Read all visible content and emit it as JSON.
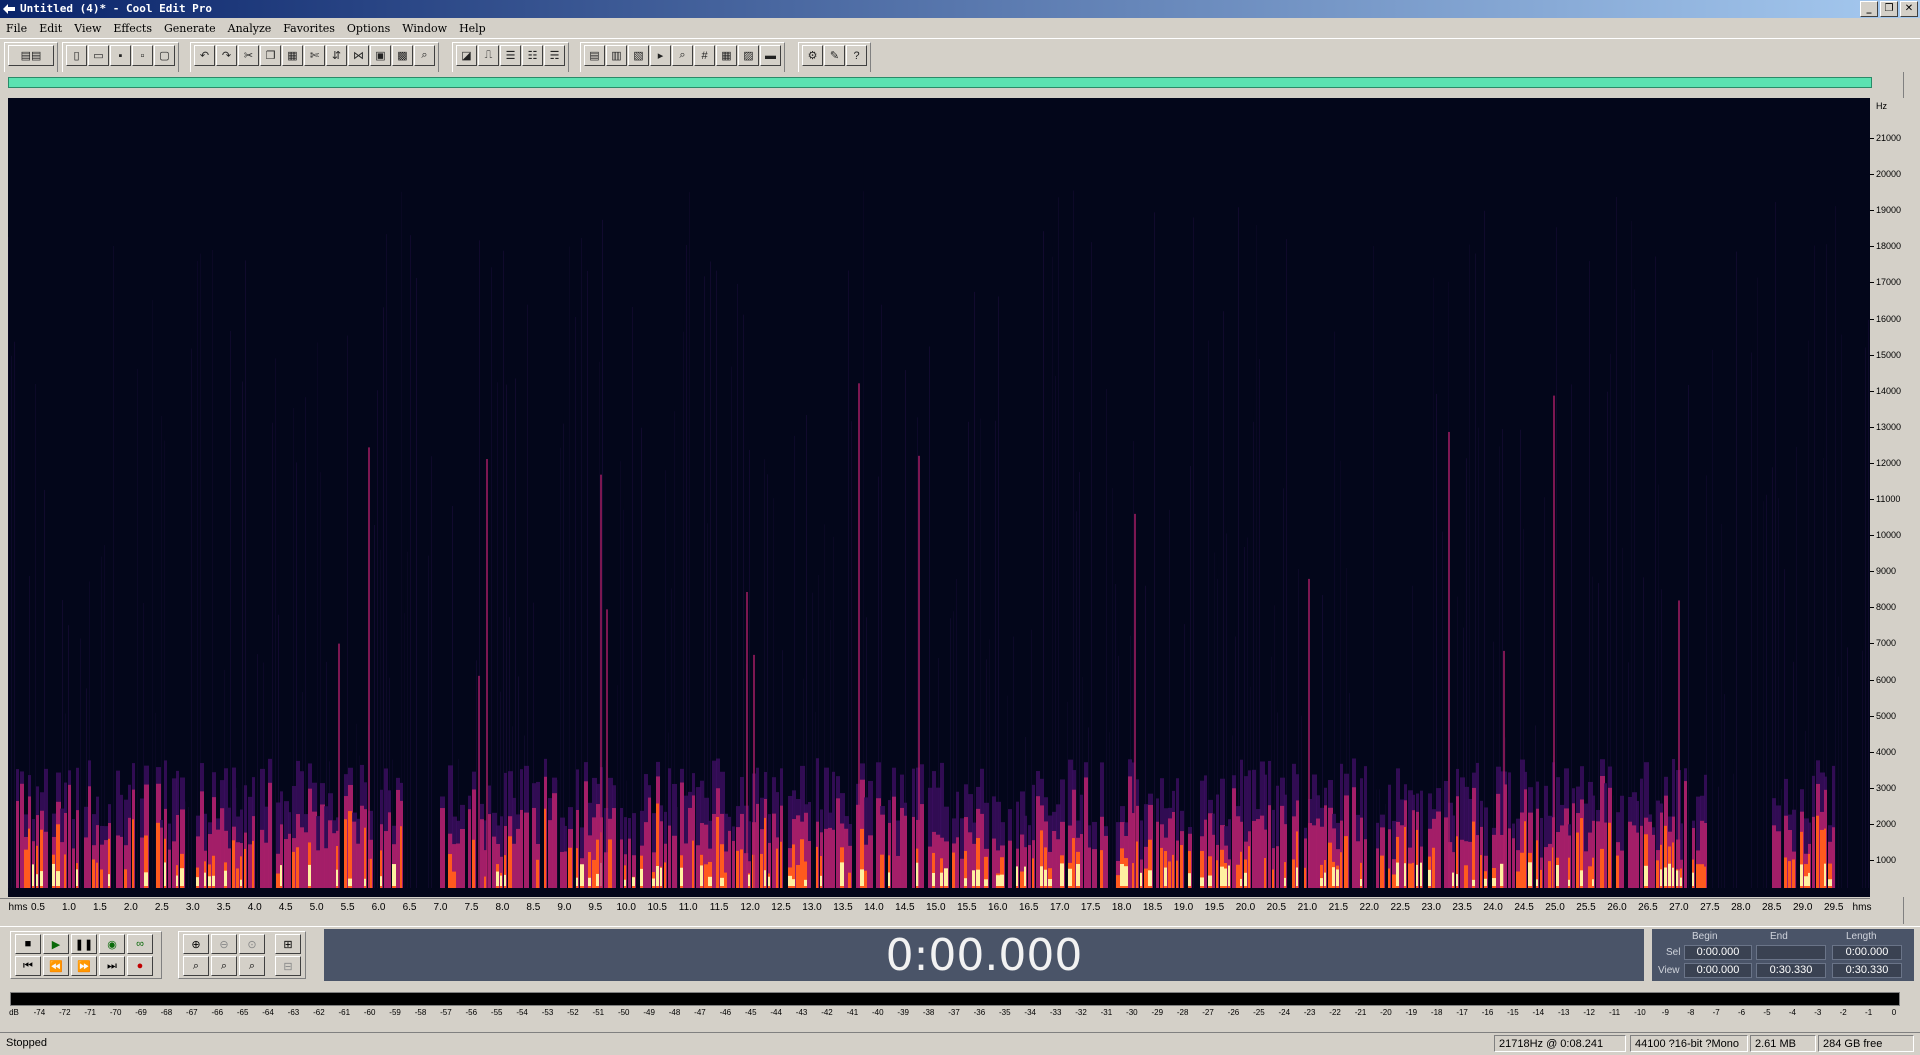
{
  "window": {
    "title": "Untitled (4)* - Cool Edit Pro",
    "min": "_",
    "restore": "❐",
    "close": "✕"
  },
  "menu": [
    "File",
    "Edit",
    "View",
    "Effects",
    "Generate",
    "Analyze",
    "Favorites",
    "Options",
    "Window",
    "Help"
  ],
  "spectrogram": {
    "freq_unit": "Hz",
    "freq_labels": [
      "21000",
      "20000",
      "19000",
      "18000",
      "17000",
      "16000",
      "15000",
      "14000",
      "13000",
      "12000",
      "11000",
      "10000",
      "9000",
      "8000",
      "7000",
      "6000",
      "5000",
      "4000",
      "3000",
      "2000",
      "1000"
    ],
    "time_start_label": "hms",
    "time_end_label": "hms",
    "time_labels": [
      "0.5",
      "1.0",
      "1.5",
      "2.0",
      "2.5",
      "3.0",
      "3.5",
      "4.0",
      "4.5",
      "5.0",
      "5.5",
      "6.0",
      "6.5",
      "7.0",
      "7.5",
      "8.0",
      "8.5",
      "9.0",
      "9.5",
      "10.0",
      "10.5",
      "11.0",
      "11.5",
      "12.0",
      "12.5",
      "13.0",
      "13.5",
      "14.0",
      "14.5",
      "15.0",
      "15.5",
      "16.0",
      "16.5",
      "17.0",
      "17.5",
      "18.0",
      "18.5",
      "19.0",
      "19.5",
      "20.0",
      "20.5",
      "21.0",
      "21.5",
      "22.0",
      "22.5",
      "23.0",
      "23.5",
      "24.0",
      "24.5",
      "25.0",
      "25.5",
      "26.0",
      "26.5",
      "27.0",
      "27.5",
      "28.0",
      "28.5",
      "29.0",
      "29.5"
    ],
    "colors": {
      "background": "#03061a",
      "low": "#3a0e5e",
      "mid": "#b0206a",
      "high": "#ff5a1e",
      "peak": "#fff0a0"
    }
  },
  "transport": {
    "time": "0:00.000"
  },
  "selection": {
    "begin_header": "Begin",
    "end_header": "End",
    "length_header": "Length",
    "sel_label": "Sel",
    "view_label": "View",
    "sel_begin": "0:00.000",
    "sel_end": "",
    "sel_length": "0:00.000",
    "view_begin": "0:00.000",
    "view_end": "0:30.330",
    "view_length": "0:30.330"
  },
  "level_meter": {
    "labels": [
      "dB",
      "-74",
      "-72",
      "-71",
      "-70",
      "-69",
      "-68",
      "-67",
      "-66",
      "-65",
      "-64",
      "-63",
      "-62",
      "-61",
      "-60",
      "-59",
      "-58",
      "-57",
      "-56",
      "-55",
      "-54",
      "-53",
      "-52",
      "-51",
      "-50",
      "-49",
      "-48",
      "-47",
      "-46",
      "-45",
      "-44",
      "-43",
      "-42",
      "-41",
      "-40",
      "-39",
      "-38",
      "-37",
      "-36",
      "-35",
      "-34",
      "-33",
      "-32",
      "-31",
      "-30",
      "-29",
      "-28",
      "-27",
      "-26",
      "-25",
      "-24",
      "-23",
      "-22",
      "-21",
      "-20",
      "-19",
      "-18",
      "-17",
      "-16",
      "-15",
      "-14",
      "-13",
      "-12",
      "-11",
      "-10",
      "-9",
      "-8",
      "-7",
      "-6",
      "-5",
      "-4",
      "-3",
      "-2",
      "-1",
      "0"
    ]
  },
  "status": {
    "state": "Stopped",
    "cursor": "21718Hz @  0:08.241",
    "format": "44100 ?16-bit ?Mono",
    "size": "2.61 MB",
    "free": "284 GB free"
  }
}
